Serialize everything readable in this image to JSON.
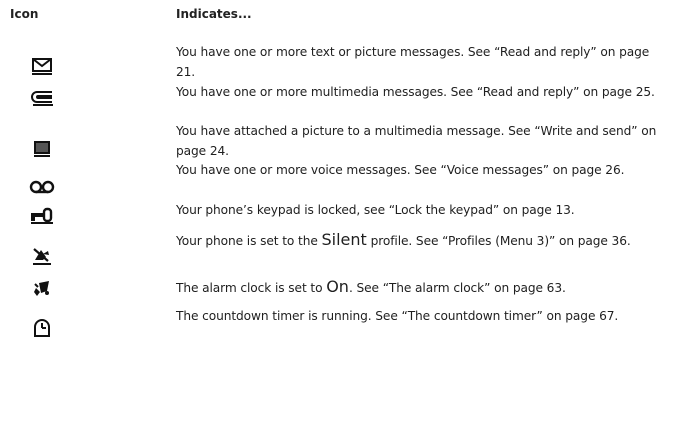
{
  "header": {
    "icon_col": "Icon",
    "indicates_col": "Indicates..."
  },
  "rows": [
    {
      "icon": "envelope-icon",
      "text": "You have one or more text or picture messages. See “Read and reply” on page 21."
    },
    {
      "icon": "multimedia-message-icon",
      "text": "You have one or more multimedia messages. See “Read and reply” on page 25."
    },
    {
      "icon": "picture-attachment-icon",
      "text": "You have attached a picture to a multimedia message. See “Write and send” on page 24."
    },
    {
      "icon": "voicemail-icon",
      "text": "You have one or more voice messages. See “Voice messages” on page 26."
    },
    {
      "icon": "keypad-lock-icon",
      "text": "Your phone’s keypad is locked, see “Lock the keypad” on page 13."
    },
    {
      "icon": "silent-profile-icon",
      "text_before": "Your phone is set to the ",
      "text_emph": "Silent",
      "text_after": " profile. See “Profiles (Menu 3)” on page 36."
    },
    {
      "icon": "alarm-clock-icon",
      "text_before": "The alarm clock is set to ",
      "text_emph": "On",
      "text_after": ". See “The alarm clock” on page 63."
    },
    {
      "icon": "countdown-timer-icon",
      "text": "The countdown timer is running. See “The countdown timer” on page 67."
    }
  ]
}
